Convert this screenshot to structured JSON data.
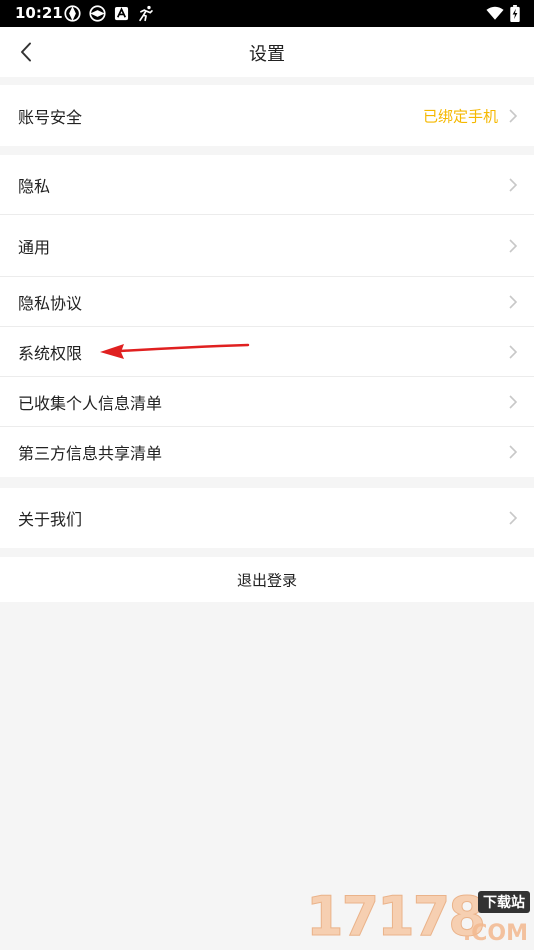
{
  "status_bar": {
    "time": "10:21"
  },
  "header": {
    "title": "设置"
  },
  "account": {
    "label": "账号安全",
    "value": "已绑定手机",
    "value_color": "#f5b800"
  },
  "menu": {
    "items": [
      {
        "label": "隐私"
      },
      {
        "label": "通用"
      },
      {
        "label": "隐私协议"
      },
      {
        "label": "系统权限"
      },
      {
        "label": "已收集个人信息清单"
      },
      {
        "label": "第三方信息共享清单"
      }
    ]
  },
  "about": {
    "label": "关于我们"
  },
  "logout": {
    "label": "退出登录"
  },
  "watermark": {
    "digits": "17178",
    "badge": "下载站",
    "suffix": ".COM"
  },
  "colors": {
    "annotation_arrow": "#e02020",
    "chevron": "#c8c8c8"
  }
}
